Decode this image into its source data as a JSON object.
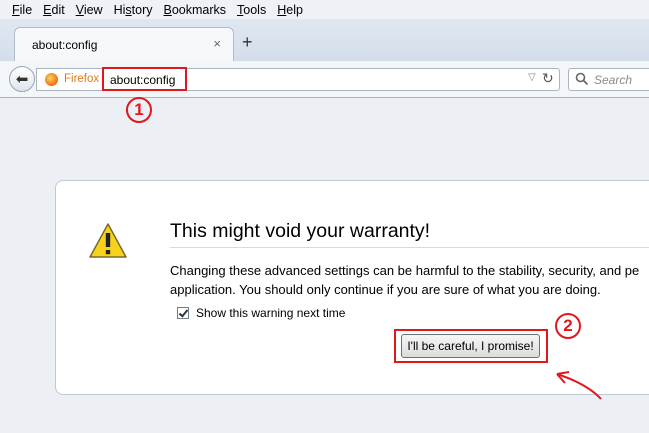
{
  "menubar": {
    "items": [
      {
        "label": "File",
        "underline": "F",
        "rest": "ile"
      },
      {
        "label": "Edit",
        "underline": "E",
        "rest": "dit"
      },
      {
        "label": "View",
        "underline": "V",
        "rest": "iew"
      },
      {
        "label": "History",
        "underline": "s",
        "pre": "Hi",
        "rest": "tory"
      },
      {
        "label": "Bookmarks",
        "underline": "B",
        "rest": "ookmarks"
      },
      {
        "label": "Tools",
        "underline": "T",
        "rest": "ools"
      },
      {
        "label": "Help",
        "underline": "H",
        "rest": "elp"
      }
    ]
  },
  "tab": {
    "title": "about:config",
    "close": "×"
  },
  "new_tab": "+",
  "navbar": {
    "identity_label": "Firefox",
    "url": "about:config",
    "search_placeholder": "Search"
  },
  "annotations": {
    "step1": "1",
    "step2": "2",
    "color": "#e0181c"
  },
  "warning": {
    "title": "This might void your warranty!",
    "body_line1": "Changing these advanced settings can be harmful to the stability, security, and pe",
    "body_line2": "application. You should only continue if you are sure of what you are doing.",
    "checkbox_label": "Show this warning next time",
    "checkbox_checked": true,
    "button_label": "I'll be careful, I promise!"
  }
}
